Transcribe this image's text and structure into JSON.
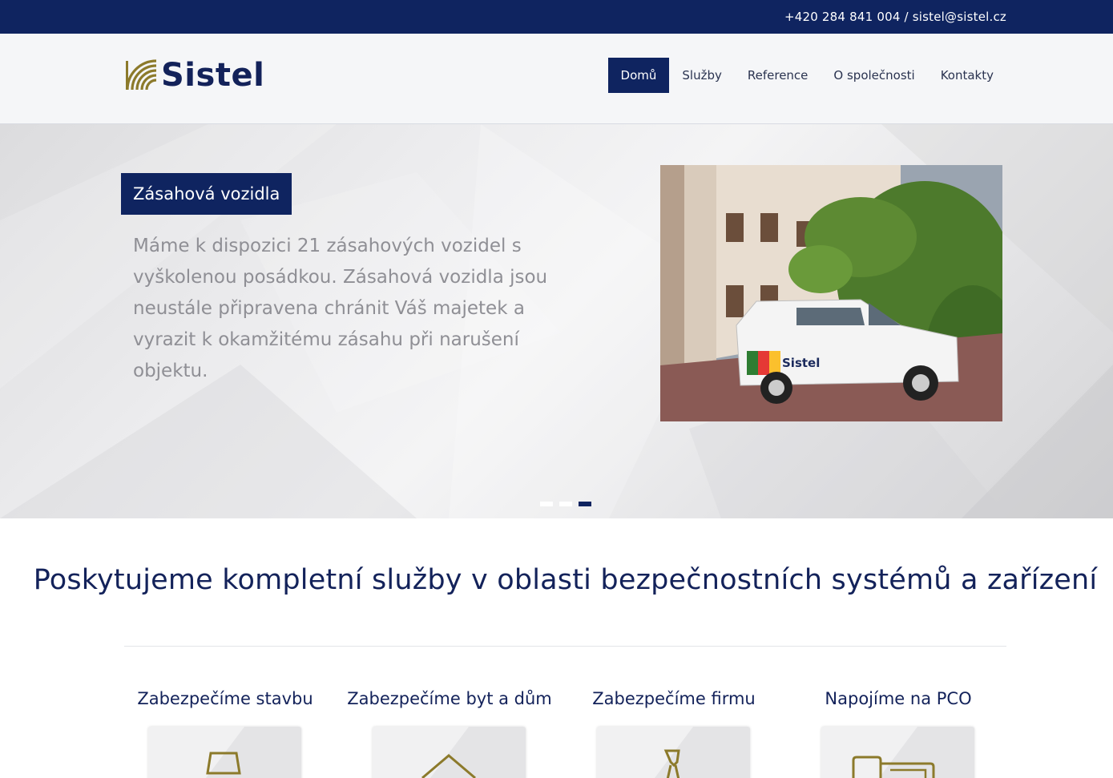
{
  "topbar": {
    "contact": "+420 284 841 004 / sistel@sistel.cz"
  },
  "header": {
    "logo_text": "Sistel",
    "nav": [
      {
        "label": "Domů",
        "active": true
      },
      {
        "label": "Služby",
        "active": false
      },
      {
        "label": "Reference",
        "active": false
      },
      {
        "label": "O společnosti",
        "active": false
      },
      {
        "label": "Kontakty",
        "active": false
      }
    ]
  },
  "hero": {
    "slide_title": "Zásahová vozidla",
    "slide_text": "Máme k dispozici 21 zásahových vozidel s vyškolenou posádkou. Zásahová vozidla jsou neustále připravena chránit Váš majetek a vyrazit k okamžitému zásahu při narušení objektu.",
    "photo_van_text": "Sistel",
    "slides_total": 3,
    "active_slide": 3
  },
  "services": {
    "headline": "Poskytujeme kompletní služby v oblasti bezpečnostních systémů a zařízení",
    "items": [
      {
        "title": "Zabezpečíme stavbu",
        "icon": "building-icon"
      },
      {
        "title": "Zabezpečíme byt a dům",
        "icon": "house-icon"
      },
      {
        "title": "Zabezpečíme firmu",
        "icon": "businessman-icon"
      },
      {
        "title": "Napojíme na PCO",
        "icon": "monitor-icon"
      }
    ]
  },
  "colors": {
    "primary": "#0f2460",
    "gold": "#8c7a2b",
    "text_gray": "#8f8f95"
  }
}
